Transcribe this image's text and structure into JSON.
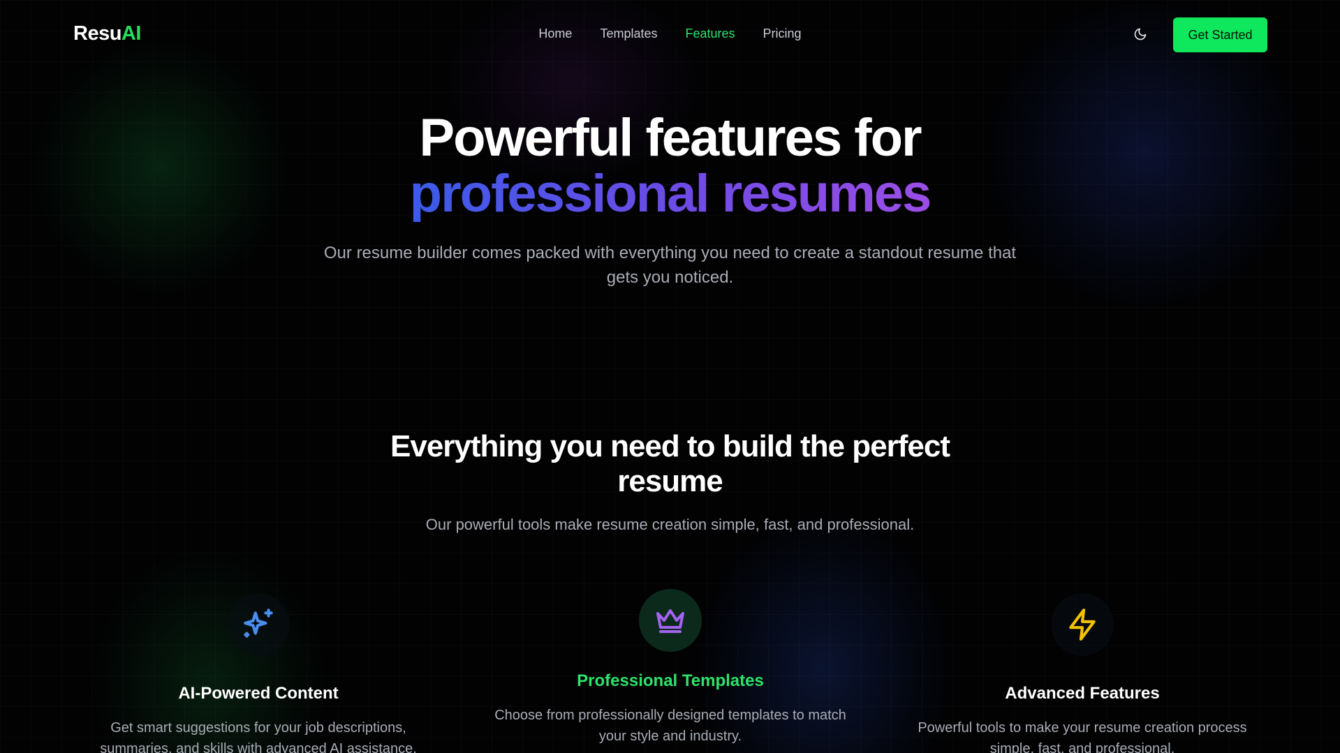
{
  "nav": {
    "logo_main": "Resu",
    "logo_accent": "AI",
    "links": [
      {
        "label": "Home",
        "active": false
      },
      {
        "label": "Templates",
        "active": false
      },
      {
        "label": "Features",
        "active": true
      },
      {
        "label": "Pricing",
        "active": false
      }
    ],
    "theme_icon": "moon-icon",
    "cta_label": "Get Started"
  },
  "hero": {
    "title_line1": "Powerful features for",
    "title_line2": "professional resumes",
    "subtitle": "Our resume builder comes packed with everything you need to create a standout resume that gets you noticed."
  },
  "section": {
    "title": "Everything you need to build the perfect resume",
    "subtitle": "Our powerful tools make resume creation simple, fast, and professional."
  },
  "features": [
    {
      "icon": "sparkles-icon",
      "icon_color": "#4b8ef0",
      "title": "AI-Powered Content",
      "description": "Get smart suggestions for your job descriptions, summaries, and skills with advanced AI assistance."
    },
    {
      "icon": "crown-icon",
      "icon_color": "#a463f0",
      "title": "Professional Templates",
      "description": "Choose from professionally designed templates to match your style and industry."
    },
    {
      "icon": "lightning-icon",
      "icon_color": "#f2c200",
      "title": "Advanced Features",
      "description": "Powerful tools to make your resume creation process simple, fast, and professional."
    }
  ],
  "colors": {
    "accent_green": "#0fe85c",
    "active_link": "#2ee36a",
    "gradient_start": "#3b5be8",
    "gradient_end": "#9b4ee6"
  }
}
